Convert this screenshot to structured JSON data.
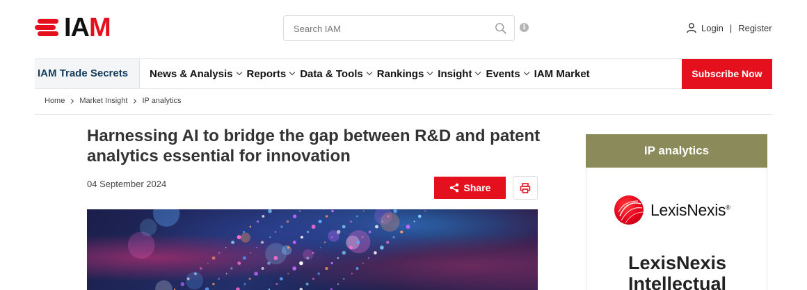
{
  "brand": {
    "logo_text_i_a": "IA",
    "logo_text_m": "M"
  },
  "search": {
    "placeholder": "Search IAM"
  },
  "account": {
    "login": "Login",
    "separator": "|",
    "register": "Register"
  },
  "nav": {
    "brand_label": "IAM Trade Secrets",
    "items": [
      {
        "label": "News & Analysis",
        "has_dropdown": true
      },
      {
        "label": "Reports",
        "has_dropdown": true
      },
      {
        "label": "Data & Tools",
        "has_dropdown": true
      },
      {
        "label": "Rankings",
        "has_dropdown": true
      },
      {
        "label": "Insight",
        "has_dropdown": true
      },
      {
        "label": "Events",
        "has_dropdown": true
      },
      {
        "label": "IAM Market",
        "has_dropdown": false
      }
    ],
    "subscribe_label": "Subscribe Now"
  },
  "breadcrumb": [
    "Home",
    "Market Insight",
    "IP analytics"
  ],
  "article": {
    "title": "Harnessing AI to bridge the gap between R&D and patent analytics essential for innovation",
    "date": "04 September 2024",
    "share_label": "Share"
  },
  "sidebar": {
    "heading": "IP analytics",
    "sponsor_logo_text": "LexisNexis",
    "sponsor_logo_mark": "®",
    "sponsor_name": "LexisNexis Intellectual"
  },
  "colors": {
    "accent": "#e5101d",
    "nav_brand": "#153b5b",
    "sidebar_head": "#8b8a5a"
  }
}
